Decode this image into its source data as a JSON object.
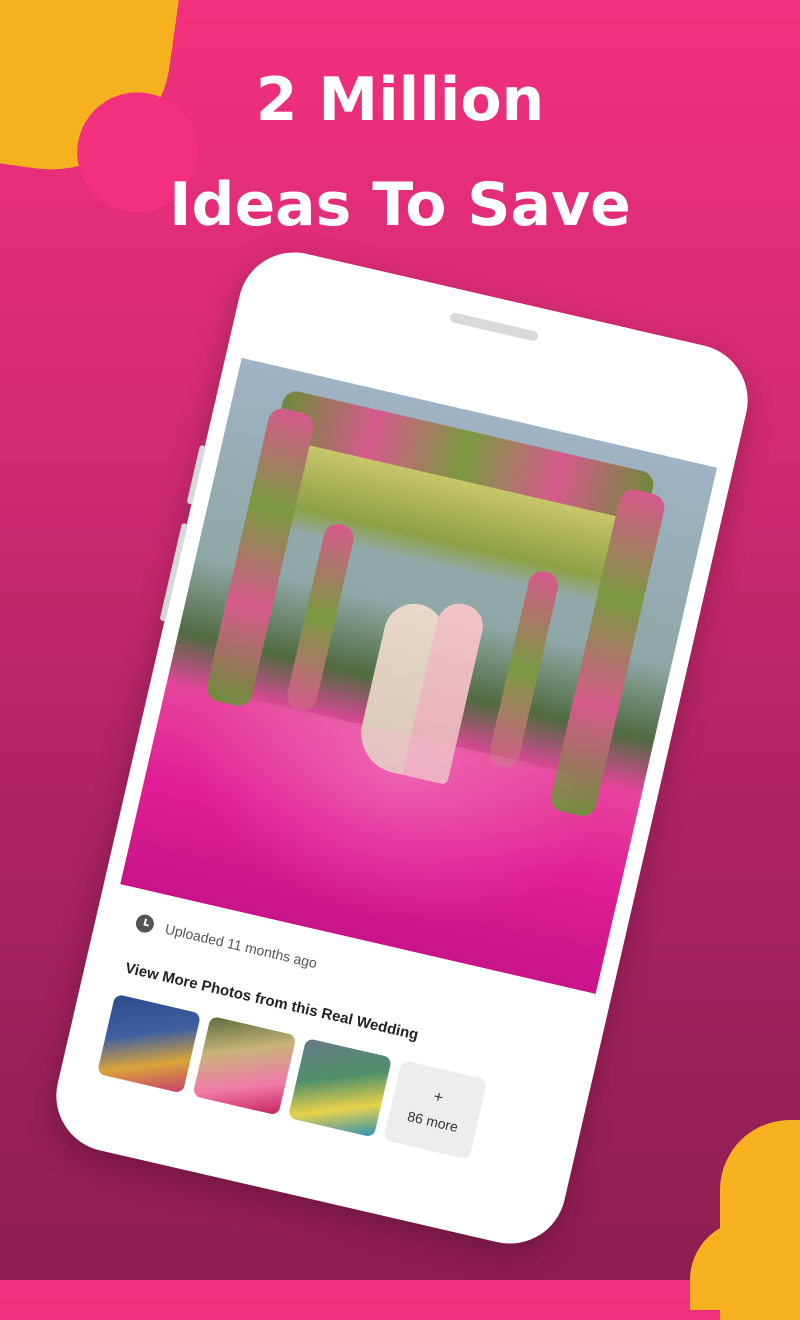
{
  "headline": {
    "line1": "2 Million",
    "line2": "Ideas To Save"
  },
  "colors": {
    "background_top": "#f3307d",
    "background_bottom": "#8e1d51",
    "accent_blob": "#f6b21e",
    "headline_text": "#ffffff"
  },
  "photo_details": {
    "uploaded_text": "Uploaded 11 months ago",
    "icon": "clock-icon"
  },
  "more_photos": {
    "title": "View More Photos from this Real Wedding",
    "more_plus": "+",
    "more_count": "86 more"
  }
}
